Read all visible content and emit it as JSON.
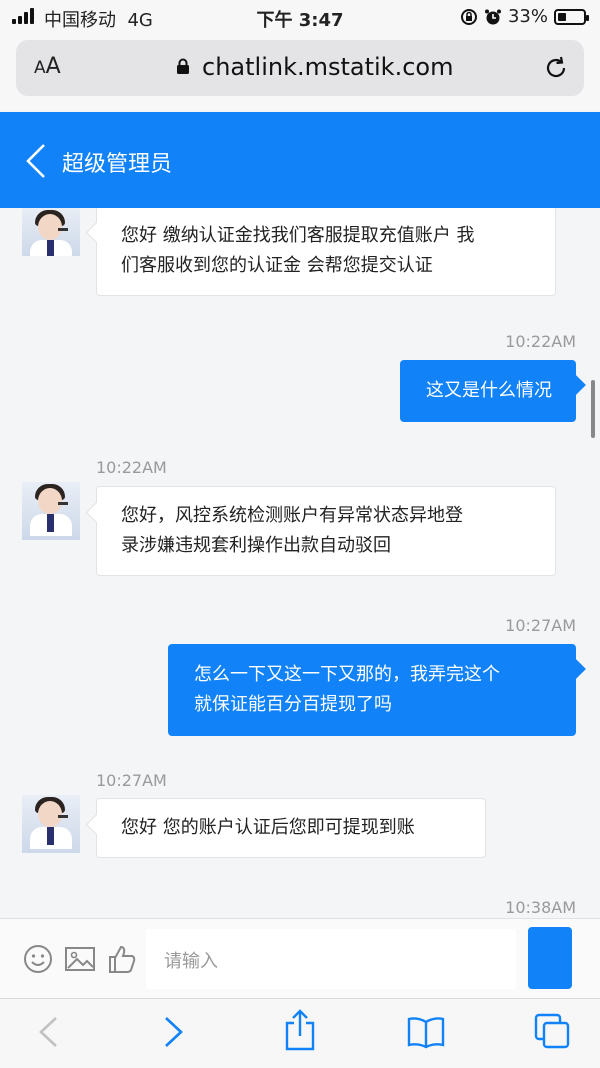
{
  "status_bar": {
    "carrier": "中国移动",
    "network": "4G",
    "time": "下午 3:47",
    "battery_percent": "33%",
    "battery_level": 0.33
  },
  "browser": {
    "text_size_label": "AA",
    "url": "chatlink.mstatik.com"
  },
  "header": {
    "title": "超级管理员"
  },
  "messages": [
    {
      "side": "left",
      "timestamp": "",
      "lines": [
        "您好 缴纳认证金找我们客服提取充值账户 我",
        "们客服收到您的认证金 会帮您提交认证"
      ]
    },
    {
      "side": "right",
      "timestamp": "10:22AM",
      "lines": [
        "这又是什么情况"
      ]
    },
    {
      "side": "left",
      "timestamp": "10:22AM",
      "lines": [
        "您好，风控系统检测账户有异常状态异地登",
        "录涉嫌违规套利操作出款自动驳回"
      ]
    },
    {
      "side": "right",
      "timestamp": "10:27AM",
      "lines": [
        "怎么一下又这一下又那的，我弄完这个",
        "就保证能百分百提现了吗"
      ]
    },
    {
      "side": "left",
      "timestamp": "10:27AM",
      "lines": [
        "您好 您的账户认证后您即可提现到账"
      ]
    },
    {
      "side": "right",
      "timestamp": "10:38AM",
      "lines": []
    }
  ],
  "input": {
    "placeholder": "请输入",
    "icons": [
      "emoji-icon",
      "image-icon",
      "thumbs-up-icon"
    ]
  },
  "toolbar": {
    "icons": [
      "back-arrow-icon",
      "forward-arrow-icon",
      "share-icon",
      "bookmarks-icon",
      "tabs-icon"
    ]
  },
  "colors": {
    "accent": "#1182f7",
    "background": "#f4f5f7"
  }
}
